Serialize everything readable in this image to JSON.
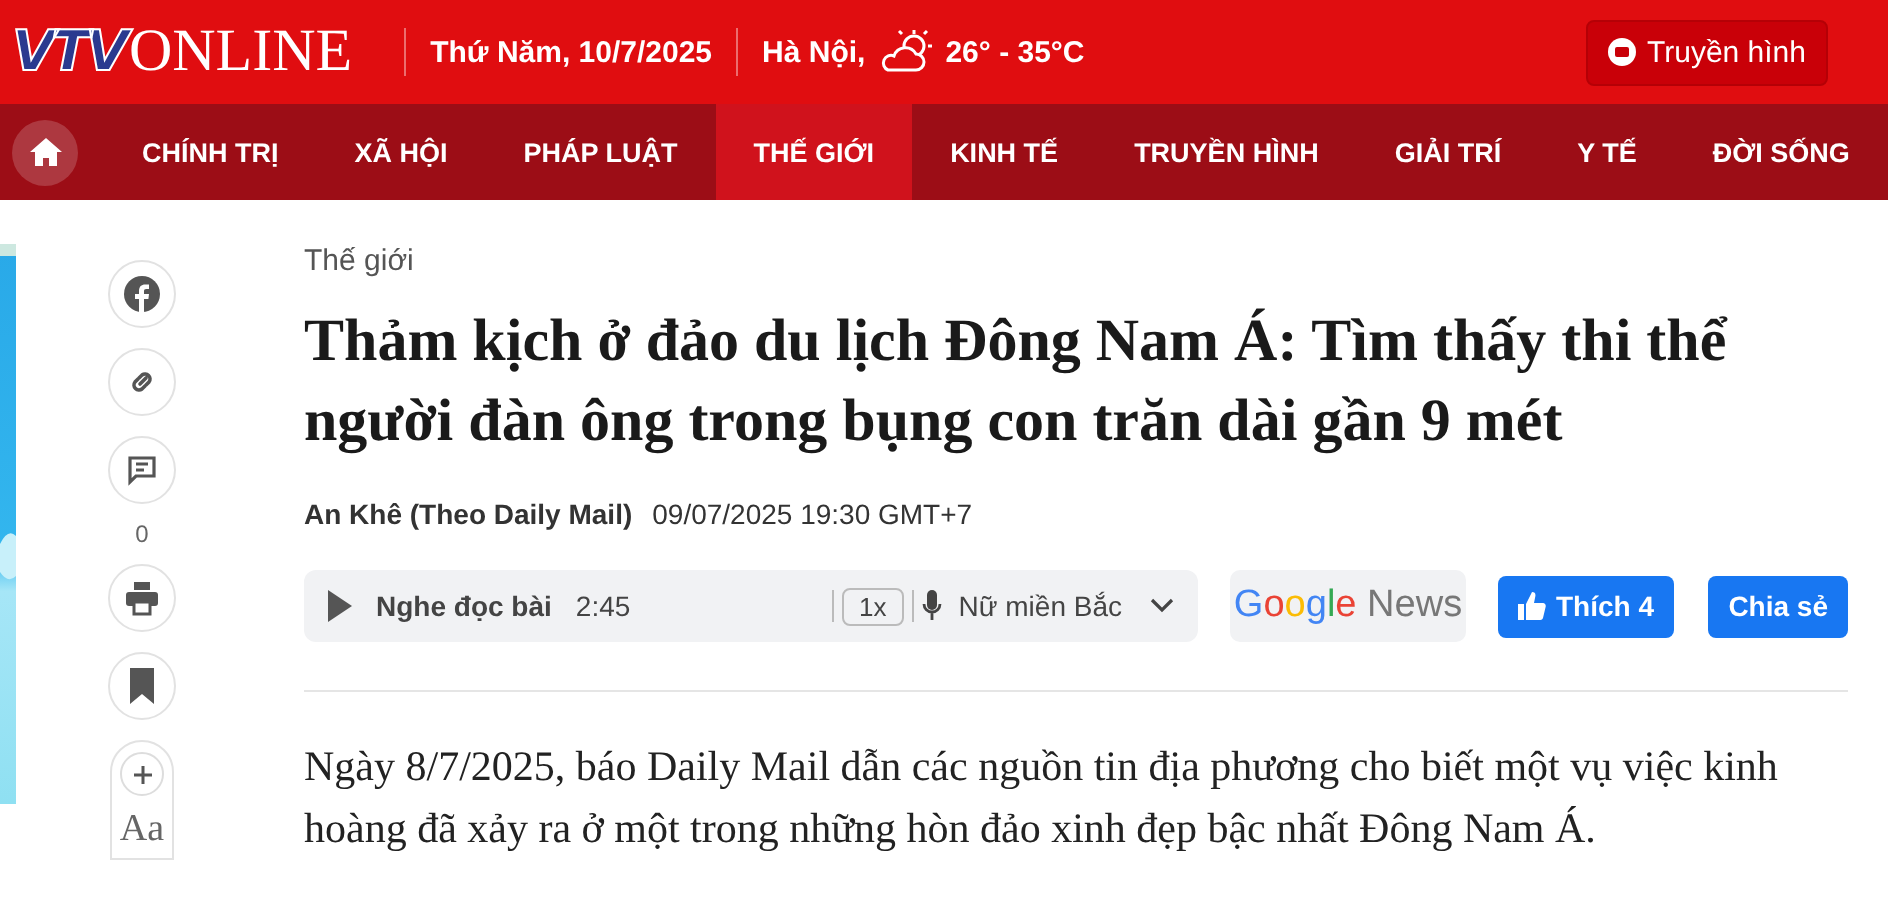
{
  "header": {
    "logo": {
      "first": "VTV",
      "second": "ONLINE"
    },
    "date": "Thứ Năm, 10/7/2025",
    "city": "Hà Nội,",
    "temperature": "26° - 35°C",
    "tv_button": "Truyền hình"
  },
  "nav": [
    {
      "label": "CHÍNH TRỊ",
      "selected": false
    },
    {
      "label": "XÃ HỘI",
      "selected": false
    },
    {
      "label": "PHÁP LUẬT",
      "selected": false
    },
    {
      "label": "THẾ GIỚI",
      "selected": true
    },
    {
      "label": "KINH TẾ",
      "selected": false
    },
    {
      "label": "TRUYỀN HÌNH",
      "selected": false
    },
    {
      "label": "GIẢI TRÍ",
      "selected": false
    },
    {
      "label": "Y TẾ",
      "selected": false
    },
    {
      "label": "ĐỜI SỐNG",
      "selected": false
    }
  ],
  "share_bar": {
    "comment_count": "0",
    "font_size_label": "Aa"
  },
  "article": {
    "category": "Thế giới",
    "title": "Thảm kịch ở đảo du lịch Đông Nam Á: Tìm thấy thi thể người đàn ông trong bụng con trăn dài gần 9 mét",
    "author": "An Khê (Theo Daily Mail)",
    "datetime": "09/07/2025 19:30 GMT+7",
    "audio": {
      "label": "Nghe đọc bài",
      "duration": "2:45",
      "speed": "1x",
      "voice": "Nữ miền Bắc"
    },
    "google_news": "Google News",
    "like_button": "Thích 4",
    "share_button": "Chia sẻ",
    "lead": "Ngày 8/7/2025, báo Daily Mail dẫn các nguồn tin địa phương cho biết một vụ việc kinh hoàng đã xảy ra ở một trong những hòn đảo xinh đẹp bậc nhất Đông Nam Á."
  }
}
